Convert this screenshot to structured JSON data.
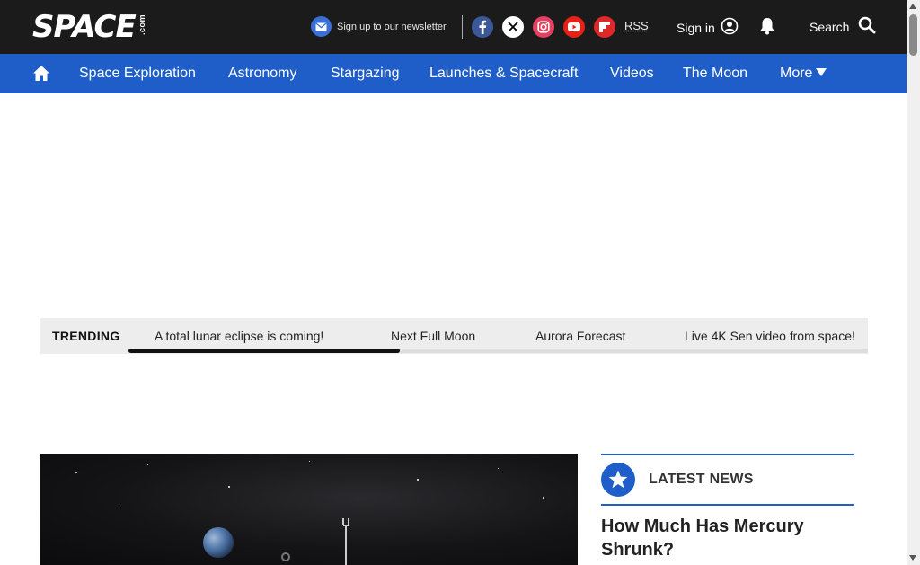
{
  "header": {
    "logo_text": "SPACE",
    "logo_suffix": ".com",
    "newsletter_label": "Sign up to our newsletter",
    "rss_label": "RSS",
    "signin_label": "Sign in",
    "search_label": "Search",
    "social_icons": [
      "facebook-icon",
      "x-twitter-icon",
      "instagram-icon",
      "youtube-icon",
      "flipboard-icon"
    ]
  },
  "nav": {
    "items": [
      {
        "label": "Space Exploration"
      },
      {
        "label": "Astronomy"
      },
      {
        "label": "Stargazing"
      },
      {
        "label": "Launches & Spacecraft"
      },
      {
        "label": "Videos"
      },
      {
        "label": "The Moon"
      },
      {
        "label": "More"
      }
    ]
  },
  "trending": {
    "label": "TRENDING",
    "items": [
      {
        "label": "A total lunar eclipse is coming!"
      },
      {
        "label": "Next Full Moon"
      },
      {
        "label": "Aurora Forecast"
      },
      {
        "label": "Live 4K Sen video from space!"
      }
    ]
  },
  "latest_news": {
    "heading": "LATEST NEWS",
    "items": [
      {
        "title": "How Much Has Mercury Shrunk?"
      }
    ]
  },
  "colors": {
    "topbar_bg": "#1b1b1b",
    "nav_bg": "#1f5ec8",
    "accent": "#1f5ec8"
  }
}
